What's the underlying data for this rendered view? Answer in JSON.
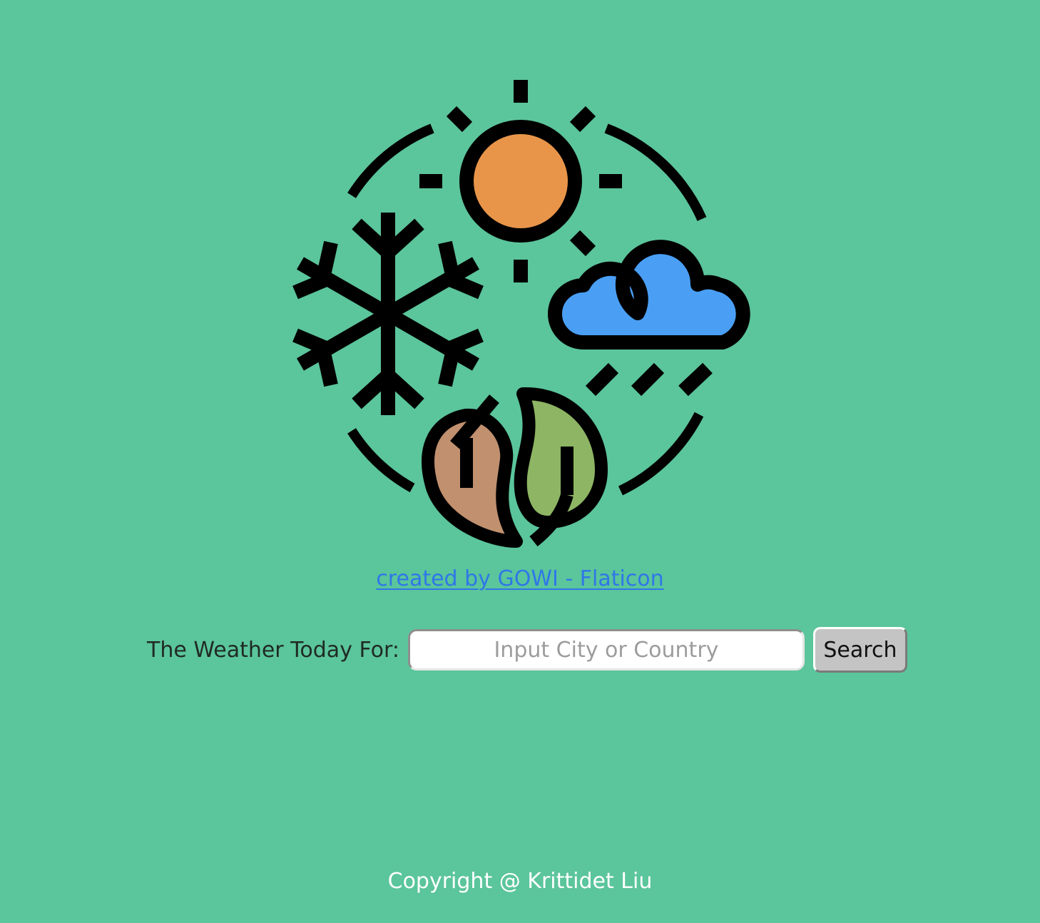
{
  "logo": {
    "icon": "four-seasons-weather-icon",
    "colors": {
      "sun": "#e8954a",
      "cloud": "#4a9ff5",
      "leaf_brown": "#c0906f",
      "leaf_green": "#8db563",
      "outline": "#000000"
    }
  },
  "credit": {
    "link_text": "created by GOWI - Flaticon"
  },
  "search": {
    "label": "The Weather Today For:",
    "placeholder": "Input City or Country",
    "value": "",
    "button_label": "Search"
  },
  "footer": {
    "copyright": "Copyright @ Krittidet Liu"
  },
  "colors": {
    "background": "#5bc59b",
    "link": "#2f77e8",
    "button": "#c4c4c4"
  }
}
